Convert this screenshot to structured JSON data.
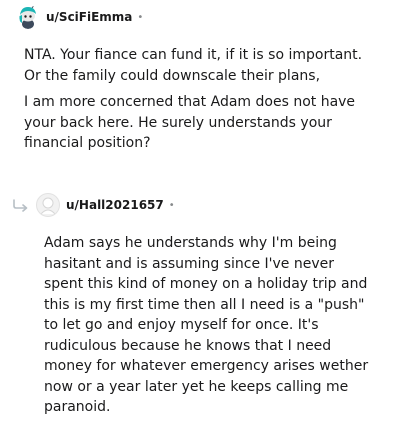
{
  "comments": [
    {
      "username": "u/SciFiEmma",
      "separator": "•",
      "avatar_icon": "snoo-avatar-icon",
      "paragraphs": [
        "NTA. Your fiance can fund it, if it is so important. Or the family could downscale their plans,",
        "I am more concerned that Adam does not have your back here. He surely understands your financial position?"
      ]
    },
    {
      "username": "u/Hall2021657",
      "separator": "•",
      "avatar_icon": "default-avatar-icon",
      "reply_icon": "reply-arrow-icon",
      "paragraphs": [
        "Adam says he understands why I'm being hasitant and is assuming since I've never spent this kind of money on a holiday trip and this is my first time then all I need is a \"push\" to let go and enjoy myself for once. It's rudiculous because he knows that I need money for whatever emergency arises wether now or a year later yet he keeps calling me paranoid."
      ]
    }
  ]
}
